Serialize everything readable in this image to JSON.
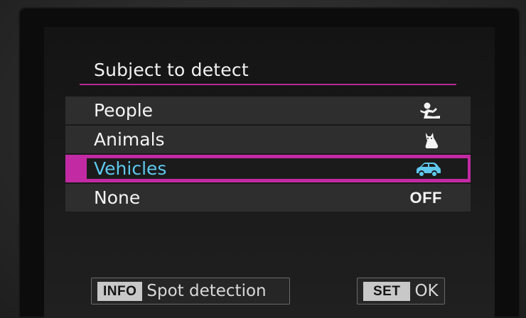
{
  "menu": {
    "title": "Subject to detect",
    "items": [
      {
        "label": "People",
        "icon": "person-icon",
        "selected": false
      },
      {
        "label": "Animals",
        "icon": "animal-icon",
        "selected": false
      },
      {
        "label": "Vehicles",
        "icon": "vehicle-icon",
        "selected": true
      },
      {
        "label": "None",
        "value_text": "OFF",
        "selected": false
      }
    ]
  },
  "footer": {
    "info_key": "INFO",
    "info_label": "Spot detection",
    "set_key": "SET",
    "set_label": "OK"
  },
  "colors": {
    "accent_magenta": "#c12aa2",
    "selected_text": "#5ec8ee",
    "row_background": "#2e2e2e"
  }
}
